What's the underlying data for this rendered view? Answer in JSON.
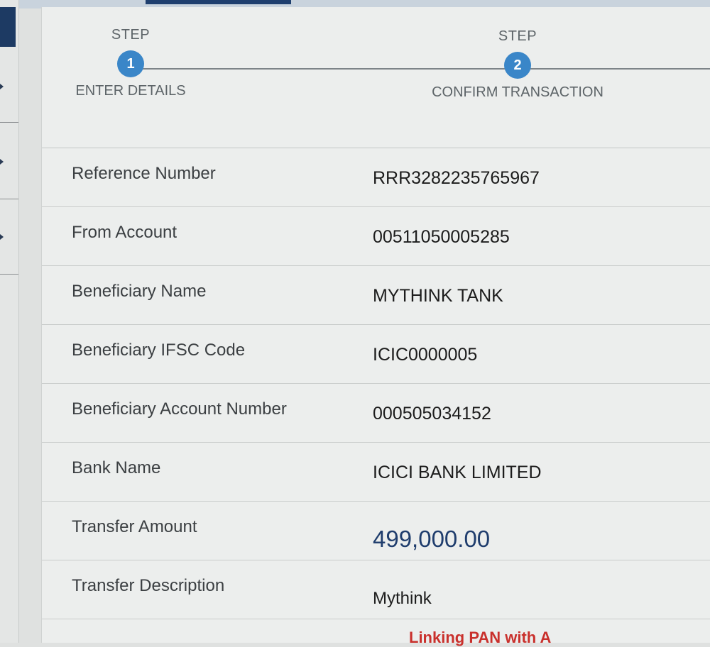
{
  "stepper": {
    "steps": [
      {
        "label": "STEP",
        "number": "1",
        "title": "ENTER DETAILS"
      },
      {
        "label": "STEP",
        "number": "2",
        "title": "CONFIRM TRANSACTION"
      }
    ]
  },
  "details": {
    "rows": [
      {
        "label": "Reference Number",
        "value": "RRR3282235765967"
      },
      {
        "label": "From Account",
        "value": "00511050005285"
      },
      {
        "label": "Beneficiary Name",
        "value": "MYTHINK TANK"
      },
      {
        "label": "Beneficiary IFSC Code",
        "value": "ICIC0000005"
      },
      {
        "label": "Beneficiary Account Number",
        "value": "000505034152"
      },
      {
        "label": "Bank Name",
        "value": "ICICI BANK LIMITED"
      },
      {
        "label": "Transfer Amount",
        "value": "499,000.00"
      },
      {
        "label": "Transfer Description",
        "value": "Mythink"
      }
    ]
  },
  "notice": {
    "text": "Linking PAN with A"
  },
  "colors": {
    "step_circle": "#3a86c8",
    "amount_text": "#1f3d6d",
    "notice_text": "#c9302c",
    "nav_accent": "#1d3a63"
  }
}
